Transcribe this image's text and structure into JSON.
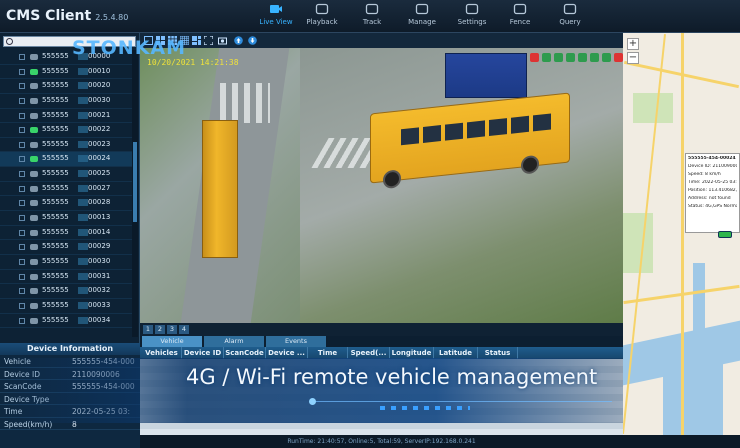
{
  "app": {
    "title": "CMS Client",
    "version": "2.5.4.80"
  },
  "nav": [
    {
      "label": "Live View",
      "icon": "camera-icon",
      "active": true
    },
    {
      "label": "Playback",
      "icon": "playback-icon"
    },
    {
      "label": "Track",
      "icon": "track-icon"
    },
    {
      "label": "Manage",
      "icon": "manage-icon"
    },
    {
      "label": "Settings",
      "icon": "gear-icon"
    },
    {
      "label": "Fence",
      "icon": "fence-icon"
    },
    {
      "label": "Query",
      "icon": "query-icon"
    }
  ],
  "watermark": "STONKAM",
  "video": {
    "timestamp": "10/20/2021  14:21:38"
  },
  "tree": {
    "rows": [
      {
        "prefix": "555555",
        "suffix": "00000",
        "online": false
      },
      {
        "prefix": "555555",
        "suffix": "00010",
        "online": true
      },
      {
        "prefix": "555555",
        "suffix": "00020",
        "online": false
      },
      {
        "prefix": "555555",
        "suffix": "00030",
        "online": false
      },
      {
        "prefix": "555555",
        "suffix": "00021",
        "online": false
      },
      {
        "prefix": "555555",
        "suffix": "00022",
        "online": true
      },
      {
        "prefix": "555555",
        "suffix": "00023",
        "online": false
      },
      {
        "prefix": "555555",
        "suffix": "00024",
        "online": true
      },
      {
        "prefix": "555555",
        "suffix": "00025",
        "online": false
      },
      {
        "prefix": "555555",
        "suffix": "00027",
        "online": false
      },
      {
        "prefix": "555555",
        "suffix": "00028",
        "online": false
      },
      {
        "prefix": "555555",
        "suffix": "00013",
        "online": false
      },
      {
        "prefix": "555555",
        "suffix": "00014",
        "online": false
      },
      {
        "prefix": "555555",
        "suffix": "00029",
        "online": false
      },
      {
        "prefix": "555555",
        "suffix": "00030",
        "online": false
      },
      {
        "prefix": "555555",
        "suffix": "00031",
        "online": false
      },
      {
        "prefix": "555555",
        "suffix": "00032",
        "online": false
      },
      {
        "prefix": "555555",
        "suffix": "00033",
        "online": false
      },
      {
        "prefix": "555555",
        "suffix": "00034",
        "online": false
      }
    ],
    "selected_index": 7
  },
  "device_info": {
    "header": "Device Information",
    "rows": [
      {
        "key": "Vehicle",
        "value": "555555-454-000"
      },
      {
        "key": "Device ID",
        "value": "2110090006"
      },
      {
        "key": "ScanCode",
        "value": "555555-454-000"
      },
      {
        "key": "Device Type",
        "value": ""
      },
      {
        "key": "Time",
        "value": "2022-05-25 03:"
      },
      {
        "key": "Speed(km/h)",
        "value": "8"
      }
    ]
  },
  "pages": [
    "1",
    "2",
    "3",
    "4"
  ],
  "tabs": [
    "Vehicle",
    "Alarm",
    "Events"
  ],
  "grid_headers": [
    "Vehicles",
    "Device ID",
    "ScanCode",
    "Device ...",
    "Time",
    "Speed(...",
    "Longitude",
    "Latitude",
    "Status"
  ],
  "banner": "4G / Wi-Fi remote vehicle management",
  "status_bar": "RunTime: 21:40:57, Online:5, Total:59, ServerIP:192.168.0.241",
  "map_popup": {
    "lines": [
      "555555-454-00024",
      "Device ID: 2110090006",
      "Speed: 8 km/h",
      "Time: 2022-05-25 03:3",
      "Position: 113.410682,2",
      "Address: not found",
      "Status: 4G,GPS Norma"
    ]
  },
  "zoom": {
    "in": "+",
    "out": "−"
  }
}
